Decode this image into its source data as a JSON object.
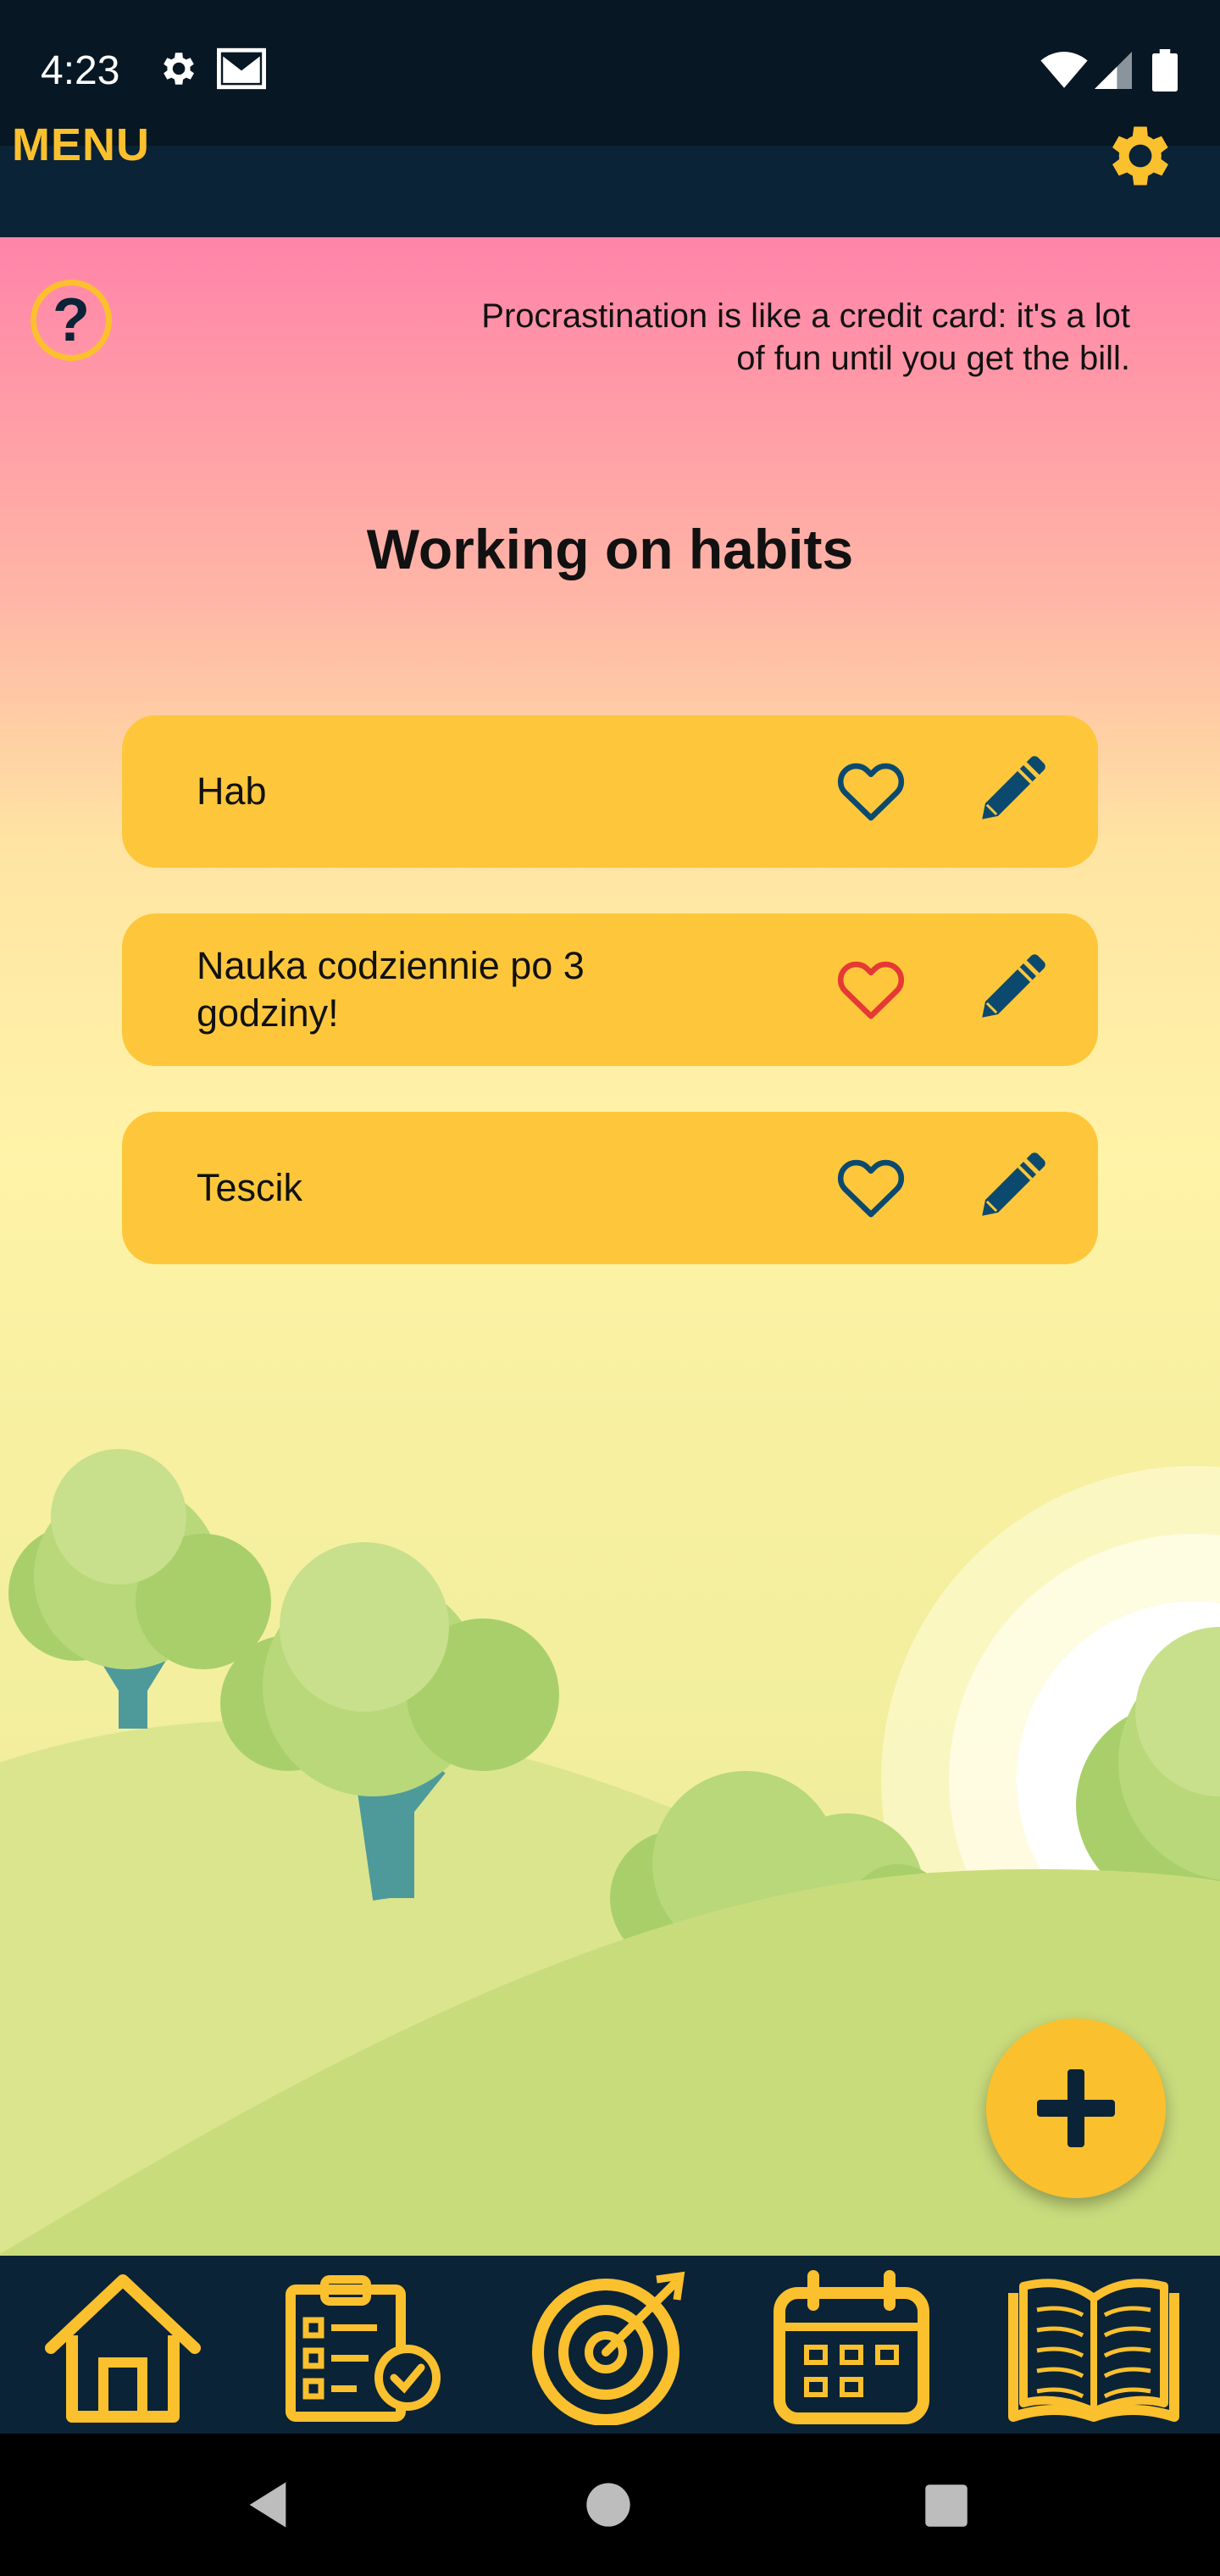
{
  "status_bar": {
    "time": "4:23",
    "icons": [
      "settings-icon",
      "gmail-icon",
      "wifi-icon",
      "signal-icon",
      "battery-icon"
    ]
  },
  "app_bar": {
    "menu_label": "MENU",
    "settings_icon": "gear-icon"
  },
  "header": {
    "help_symbol": "?",
    "quote": "Procrastination is like a credit card: it's a lot of fun until you get the bill."
  },
  "page_title": "Working on habits",
  "habits": [
    {
      "name": "Hab",
      "favorite": false
    },
    {
      "name": "Nauka codziennie po 3 godziny!",
      "favorite": true
    },
    {
      "name": "Tescik",
      "favorite": false
    }
  ],
  "fab": {
    "icon": "plus-icon"
  },
  "bottom_nav": {
    "items": [
      "home-icon",
      "checklist-icon",
      "target-icon",
      "calendar-icon",
      "book-icon"
    ]
  },
  "colors": {
    "accent": "#fbc02d",
    "card": "#fec73b",
    "navy": "#0a2336",
    "heart_favorite": "#e53935"
  }
}
